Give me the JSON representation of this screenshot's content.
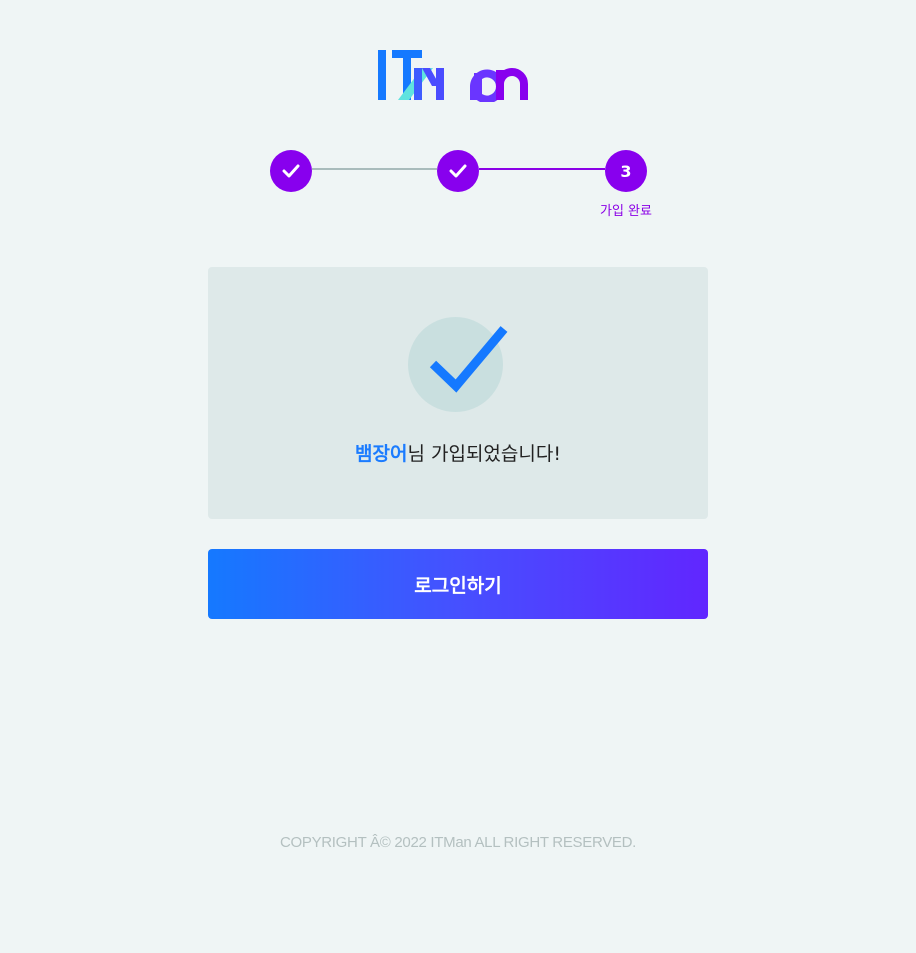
{
  "header": {
    "logo_text": "ITMan",
    "colors": {
      "logo_blue": "#1579ff",
      "logo_cyan": "#5fe3df",
      "logo_purple": "#8800ee"
    }
  },
  "stepper": {
    "steps": [
      {
        "state": "done",
        "icon": "check-icon"
      },
      {
        "state": "done",
        "icon": "check-icon"
      },
      {
        "state": "current",
        "number": "3",
        "label": "가입 완료"
      }
    ],
    "colors": {
      "active": "#8800ee",
      "inactive_line": "#a9bcbc"
    }
  },
  "result": {
    "icon": "check-mark-icon",
    "user_name": "뱀장어",
    "message_suffix": "님 가입되었습니다!"
  },
  "actions": {
    "login_label": "로그인하기",
    "gradient": [
      "#1579ff",
      "#6126ff"
    ]
  },
  "footer": {
    "copyright": "COPYRIGHT Â© 2022 ITMan ALL RIGHT RESERVED."
  }
}
